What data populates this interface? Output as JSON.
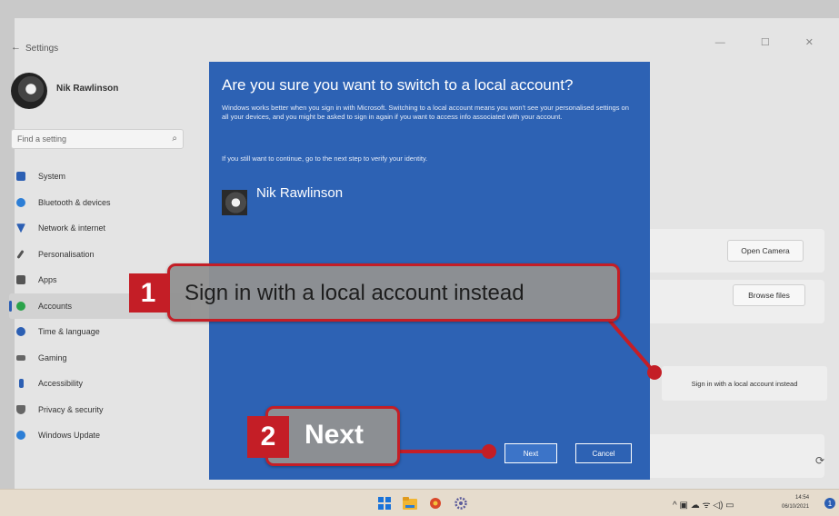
{
  "settings": {
    "app_title": "Settings",
    "back_icon": "arrow-left-icon",
    "window_controls": "—  ☐  ✕",
    "user_name": "Nik Rawlinson",
    "search_placeholder": "Find a setting",
    "nav": [
      {
        "label": "System",
        "icon": "system-icon",
        "color": "#2c5fb3"
      },
      {
        "label": "Bluetooth & devices",
        "icon": "bluetooth-icon",
        "color": "#2c7ed6"
      },
      {
        "label": "Network & internet",
        "icon": "network-icon",
        "color": "#2c5fb3"
      },
      {
        "label": "Personalisation",
        "icon": "brush-icon",
        "color": "#555555"
      },
      {
        "label": "Apps",
        "icon": "apps-icon",
        "color": "#555555"
      },
      {
        "label": "Accounts",
        "icon": "accounts-icon",
        "color": "#2aa34a",
        "active": true
      },
      {
        "label": "Time & language",
        "icon": "time-icon",
        "color": "#2c5fb3"
      },
      {
        "label": "Gaming",
        "icon": "gaming-icon",
        "color": "#666666"
      },
      {
        "label": "Accessibility",
        "icon": "accessibility-icon",
        "color": "#2c5fb3"
      },
      {
        "label": "Privacy & security",
        "icon": "shield-icon",
        "color": "#666666"
      },
      {
        "label": "Windows Update",
        "icon": "update-icon",
        "color": "#2c7ed6"
      }
    ],
    "open_camera": "Open Camera",
    "browse_files": "Browse files",
    "signin_link": "Sign in with a local account instead"
  },
  "dialog": {
    "title": "Are you sure you want to switch to a local account?",
    "body": "Windows works better when you sign in with Microsoft. Switching to a local account means you won't see your personalised settings on all your devices, and you might be asked to sign in again if you want to access info associated with your account.",
    "body2": "If you still want to continue, go to the next step to verify your identity.",
    "user_name": "Nik Rawlinson",
    "next_label": "Next",
    "cancel_label": "Cancel"
  },
  "callouts": {
    "one_number": "1",
    "one_text": "Sign in with a local account instead",
    "two_number": "2",
    "two_text": "Next"
  },
  "taskbar": {
    "tray_icons": "^ ▣ ☁ ᯤ ◁) ▭",
    "time": "14:54",
    "date": "06/10/2021"
  },
  "colors": {
    "dialog_blue": "#2d62b4",
    "callout_red": "#c41e26"
  }
}
